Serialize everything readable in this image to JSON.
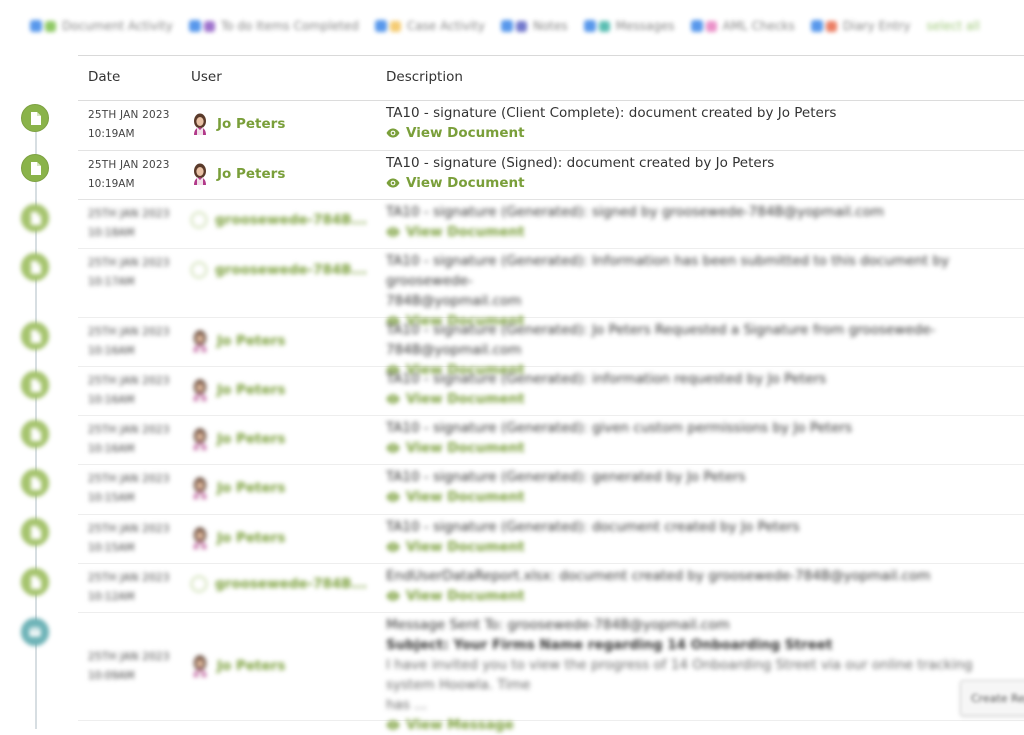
{
  "filters": [
    {
      "label": "Document Activity",
      "color": "#7cc04a"
    },
    {
      "label": "To do Items Completed",
      "color": "#8e5bc4"
    },
    {
      "label": "Case Activity",
      "color": "#f3c35c"
    },
    {
      "label": "Notes",
      "color": "#5b62c4"
    },
    {
      "label": "Messages",
      "color": "#3fb3a6"
    },
    {
      "label": "AML Checks",
      "color": "#e77fc0"
    },
    {
      "label": "Diary Entry",
      "color": "#e8694a"
    }
  ],
  "select_all_label": "select all",
  "table": {
    "headers": {
      "date": "Date",
      "user": "User",
      "description": "Description"
    }
  },
  "rows": [
    {
      "date": "25TH JAN 2023",
      "time": "10:19AM",
      "user": "Jo Peters",
      "user_type": "person",
      "lines": [
        "TA10 - signature (Client Complete): document created by Jo Peters"
      ],
      "link": "View Document",
      "icon": "document",
      "blurred": false
    },
    {
      "date": "25TH JAN 2023",
      "time": "10:19AM",
      "user": "Jo Peters",
      "user_type": "person",
      "lines": [
        "TA10 - signature (Signed): document created by Jo Peters"
      ],
      "link": "View Document",
      "icon": "document",
      "blurred": false
    },
    {
      "date": "25TH JAN 2023",
      "time": "10:18AM",
      "user": "groosewede-784B...",
      "user_type": "system",
      "lines": [
        "TA10 - signature (Generated): signed by groosewede-784B@yopmail.com"
      ],
      "link": "View Document",
      "icon": "document",
      "blurred": true
    },
    {
      "date": "25TH JAN 2023",
      "time": "10:17AM",
      "user": "groosewede-784B...",
      "user_type": "system",
      "lines": [
        "TA10 - signature (Generated): Information has been submitted to this document by groosewede-",
        "784B@yopmail.com"
      ],
      "link": "View Document",
      "icon": "document",
      "blurred": true
    },
    {
      "date": "25TH JAN 2023",
      "time": "10:16AM",
      "user": "Jo Peters",
      "user_type": "person",
      "lines": [
        "TA10 - signature (Generated): Jo Peters Requested a Signature from groosewede-784B@yopmail.com"
      ],
      "link": "View Document",
      "icon": "document",
      "blurred": true
    },
    {
      "date": "25TH JAN 2023",
      "time": "10:16AM",
      "user": "Jo Peters",
      "user_type": "person",
      "lines": [
        "TA10 - signature (Generated): information requested by Jo Peters"
      ],
      "link": "View Document",
      "icon": "document",
      "blurred": true
    },
    {
      "date": "25TH JAN 2023",
      "time": "10:16AM",
      "user": "Jo Peters",
      "user_type": "person",
      "lines": [
        "TA10 - signature (Generated): given custom permissions by Jo Peters"
      ],
      "link": "View Document",
      "icon": "document",
      "blurred": true
    },
    {
      "date": "25TH JAN 2023",
      "time": "10:15AM",
      "user": "Jo Peters",
      "user_type": "person",
      "lines": [
        "TA10 - signature (Generated): generated by Jo Peters"
      ],
      "link": "View Document",
      "icon": "document",
      "blurred": true
    },
    {
      "date": "25TH JAN 2023",
      "time": "10:15AM",
      "user": "Jo Peters",
      "user_type": "person",
      "lines": [
        "TA10 - signature (Generated): document created by Jo Peters"
      ],
      "link": "View Document",
      "icon": "document",
      "blurred": true
    },
    {
      "date": "25TH JAN 2023",
      "time": "10:12AM",
      "user": "groosewede-784B...",
      "user_type": "system",
      "lines": [
        "EndUserDataReport.xlsx: document created by groosewede-784B@yopmail.com"
      ],
      "link": "View Document",
      "icon": "document",
      "blurred": true
    },
    {
      "date": "25TH JAN 2023",
      "time": "10:09AM",
      "user": "Jo Peters",
      "user_type": "person",
      "lines": [
        "Message Sent To: groosewede-784B@yopmail.com",
        "Subject: Your Firms Name regarding 14 Onboarding Street",
        "I have invited you to view the progress of 14 Onboarding Street via our online tracking system Hoowla. Time",
        "has ..."
      ],
      "link": "View Message",
      "icon": "message",
      "blurred": true
    }
  ],
  "corner_button": "Create Rep"
}
